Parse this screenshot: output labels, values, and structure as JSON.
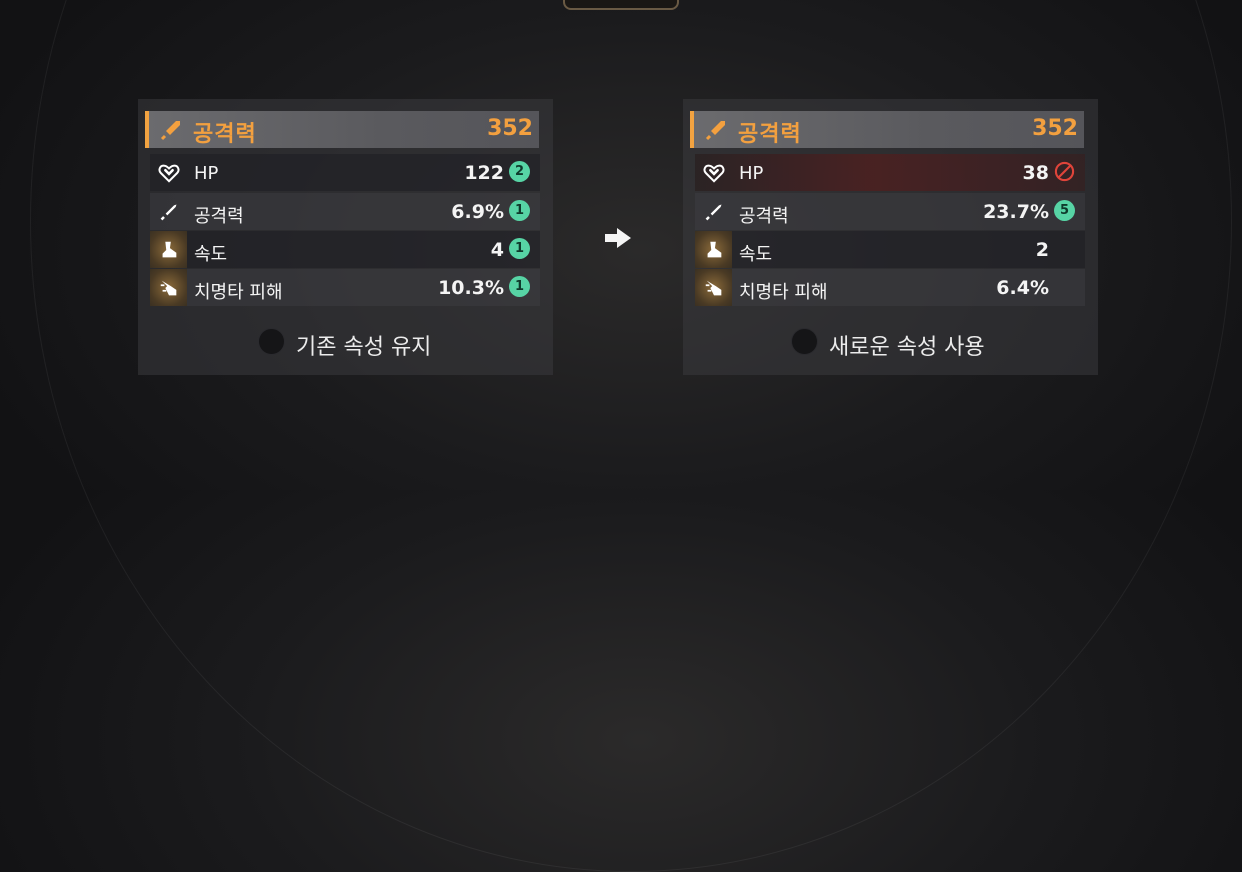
{
  "current": {
    "main": {
      "label": "공격력",
      "value": "352",
      "icon": "sword-icon"
    },
    "subs": [
      {
        "label": "HP",
        "value": "122",
        "badge": "2",
        "icon": "heart-icon"
      },
      {
        "label": "공격력",
        "value": "6.9%",
        "badge": "1",
        "icon": "sword-icon"
      },
      {
        "label": "속도",
        "value": "4",
        "badge": "1",
        "icon": "boot-icon"
      },
      {
        "label": "치명타 피해",
        "value": "10.3%",
        "badge": "1",
        "icon": "critical-hand-icon"
      }
    ],
    "choice_label": "기존 속성 유지"
  },
  "new": {
    "main": {
      "label": "공격력",
      "value": "352",
      "icon": "sword-icon"
    },
    "subs": [
      {
        "label": "HP",
        "value": "38",
        "status": "blocked",
        "icon": "heart-icon"
      },
      {
        "label": "공격력",
        "value": "23.7%",
        "badge": "5",
        "icon": "sword-icon"
      },
      {
        "label": "속도",
        "value": "2",
        "icon": "boot-icon"
      },
      {
        "label": "치명타 피해",
        "value": "6.4%",
        "icon": "critical-hand-icon"
      }
    ],
    "choice_label": "새로운 속성 사용"
  },
  "colors": {
    "accent": "#f3a03f",
    "badge": "#57d4a5",
    "blocked": "#e0443a"
  }
}
